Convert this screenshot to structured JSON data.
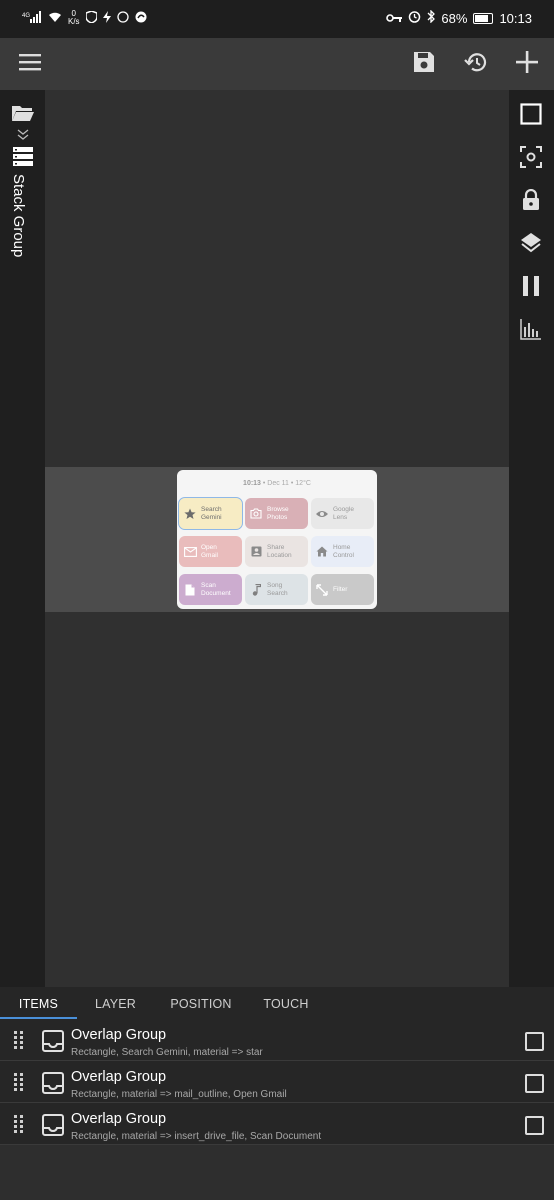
{
  "status_bar": {
    "carrier_signal": "4G",
    "net_speed_value": "0",
    "net_speed_unit": "K/s",
    "battery_percent": "68%",
    "battery_level": 0.68,
    "time": "10:13"
  },
  "toolbar": {
    "menu_icon": "hamburger-menu-icon",
    "save_icon": "floppy-save-icon",
    "history_icon": "history-restore-icon",
    "add_icon": "plus-icon"
  },
  "left_panel": {
    "folder_icon": "folder-open-icon",
    "expand_icon": "double-chevron-down-icon",
    "stack_icon": "stack-group-icon",
    "label": "Stack Group"
  },
  "right_panel": {
    "tools": [
      "select-rectangle-icon",
      "focus-center-icon",
      "lock-icon",
      "layers-icon",
      "pause-icon",
      "equalizer-icon"
    ]
  },
  "widget": {
    "time": "10:13",
    "info": " • Dec 11 • 12°C",
    "tiles": [
      {
        "label": "Search\nGemini",
        "icon": "star-icon",
        "color": "#f7ecc4",
        "text": "#6e6e6e"
      },
      {
        "label": "Browse\nPhotos",
        "icon": "camera-icon",
        "color": "#d9b0b6",
        "text": "#ffffff"
      },
      {
        "label": "Google\nLens",
        "icon": "eye-icon",
        "color": "#e8e8e8",
        "text": "#9a9a9a"
      },
      {
        "label": "Open\nGmail",
        "icon": "mail-outline-icon",
        "color": "#e9bcbc",
        "text": "#ffffff"
      },
      {
        "label": "Share\nLocation",
        "icon": "contact-location-icon",
        "color": "#eae4e2",
        "text": "#9a9a9a"
      },
      {
        "label": "Home\nControl",
        "icon": "home-icon",
        "color": "#e8edf7",
        "text": "#9a9a9a"
      },
      {
        "label": "Scan\nDocument",
        "icon": "insert-drive-file-icon",
        "color": "#ccaccf",
        "text": "#ffffff"
      },
      {
        "label": "Song\nSearch",
        "icon": "music-note-icon",
        "color": "#dde3e6",
        "text": "#9a9a9a"
      },
      {
        "label": "Filter",
        "icon": "resize-arrows-icon",
        "color": "#c9c9c9",
        "text": "#ffffff"
      }
    ]
  },
  "tabs": [
    {
      "label": "ITEMS",
      "active": true
    },
    {
      "label": "LAYER",
      "active": false
    },
    {
      "label": "POSITION",
      "active": false
    },
    {
      "label": "TOUCH",
      "active": false
    }
  ],
  "items": [
    {
      "title": "Overlap Group",
      "subtitle": "Rectangle, Search Gemini, material => star"
    },
    {
      "title": "Overlap Group",
      "subtitle": "Rectangle, material => mail_outline, Open Gmail"
    },
    {
      "title": "Overlap Group",
      "subtitle": "Rectangle, material => insert_drive_file, Scan Document"
    }
  ],
  "colors": {
    "accent": "#4a90d9",
    "panel": "#1f1f1f",
    "canvas": "#303030"
  }
}
